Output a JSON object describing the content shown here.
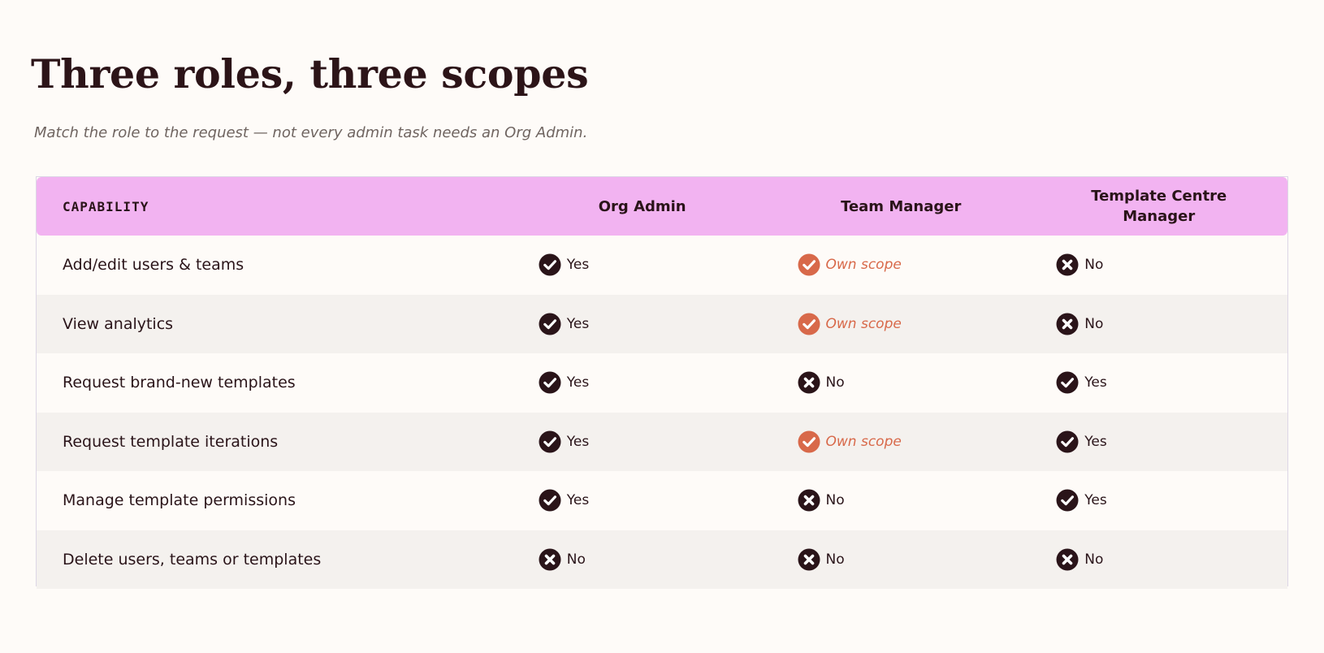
{
  "title": "Three roles, three scopes",
  "subtitle": "Match the role to the request — not every admin task needs an Org Admin.",
  "colors": {
    "header_bg": "#f2b3f1",
    "yes": "#2a1419",
    "partial": "#d8694a",
    "no": "#2a1419",
    "alt_row": "#f4f1ee"
  },
  "table": {
    "headers": {
      "capability": "CAPABILITY",
      "role1": "Org Admin",
      "role2": "Team Manager",
      "role3": "Template Centre Manager"
    },
    "rows": [
      {
        "capability": "Add/edit users & teams",
        "cells": [
          {
            "status": "yes",
            "icon": "check-circle-icon",
            "label": "Yes"
          },
          {
            "status": "partial",
            "icon": "check-circle-icon",
            "label": "Own scope"
          },
          {
            "status": "no",
            "icon": "x-circle-icon",
            "label": "No"
          }
        ]
      },
      {
        "capability": "View analytics",
        "cells": [
          {
            "status": "yes",
            "icon": "check-circle-icon",
            "label": "Yes"
          },
          {
            "status": "partial",
            "icon": "check-circle-icon",
            "label": "Own scope"
          },
          {
            "status": "no",
            "icon": "x-circle-icon",
            "label": "No"
          }
        ]
      },
      {
        "capability": "Request brand-new templates",
        "cells": [
          {
            "status": "yes",
            "icon": "check-circle-icon",
            "label": "Yes"
          },
          {
            "status": "no",
            "icon": "x-circle-icon",
            "label": "No"
          },
          {
            "status": "yes",
            "icon": "check-circle-icon",
            "label": "Yes"
          }
        ]
      },
      {
        "capability": "Request template iterations",
        "cells": [
          {
            "status": "yes",
            "icon": "check-circle-icon",
            "label": "Yes"
          },
          {
            "status": "partial",
            "icon": "check-circle-icon",
            "label": "Own scope"
          },
          {
            "status": "yes",
            "icon": "check-circle-icon",
            "label": "Yes"
          }
        ]
      },
      {
        "capability": "Manage template permissions",
        "cells": [
          {
            "status": "yes",
            "icon": "check-circle-icon",
            "label": "Yes"
          },
          {
            "status": "no",
            "icon": "x-circle-icon",
            "label": "No"
          },
          {
            "status": "yes",
            "icon": "check-circle-icon",
            "label": "Yes"
          }
        ]
      },
      {
        "capability": "Delete users, teams or templates",
        "cells": [
          {
            "status": "no",
            "icon": "x-circle-icon",
            "label": "No"
          },
          {
            "status": "no",
            "icon": "x-circle-icon",
            "label": "No"
          },
          {
            "status": "no",
            "icon": "x-circle-icon",
            "label": "No"
          }
        ]
      }
    ]
  }
}
